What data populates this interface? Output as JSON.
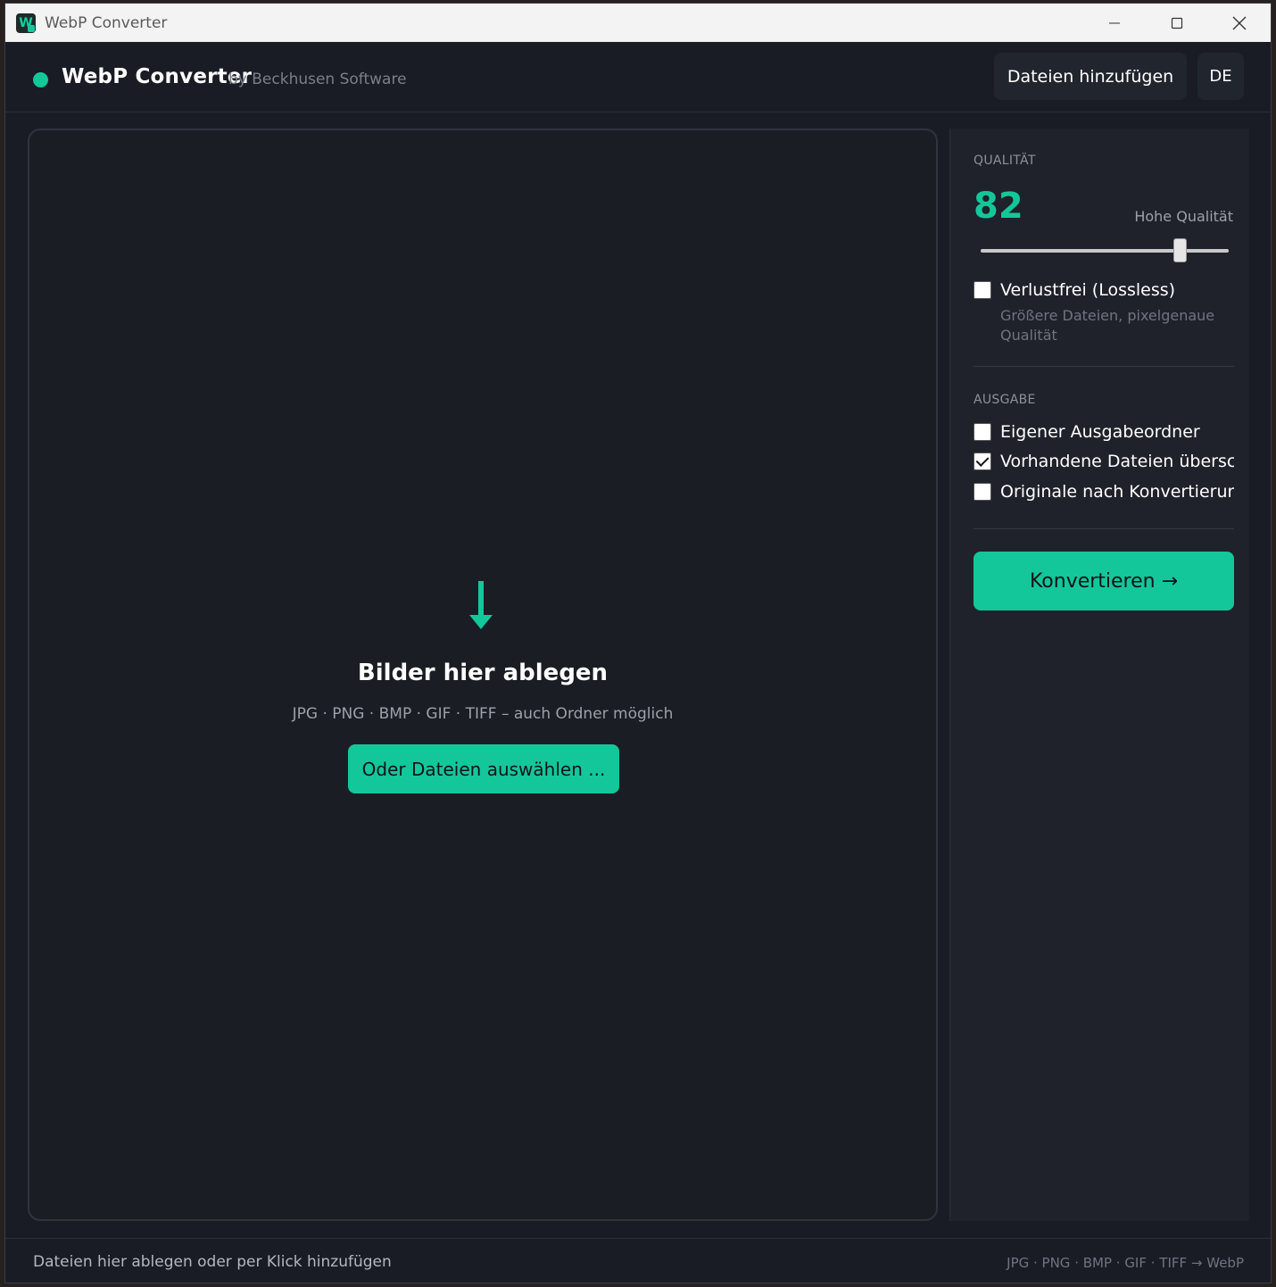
{
  "window": {
    "title": "WebP Converter",
    "controls": {
      "minimize": "—",
      "maximize": "☐",
      "close": "✕"
    }
  },
  "header": {
    "app_name": "WebP Converter",
    "byline": "by Beckhusen Software",
    "add_files_label": "Dateien hinzufügen",
    "language_label": "DE",
    "status_dot_color": "#14c79a"
  },
  "dropzone": {
    "icon": "arrow-down-icon",
    "title": "Bilder hier ablegen",
    "subtitle": "JPG · PNG · BMP · GIF · TIFF – auch Ordner möglich",
    "button_label": "Oder Dateien auswählen ..."
  },
  "sidebar": {
    "quality": {
      "section_label": "QUALITÄT",
      "value": "82",
      "description": "Hohe Qualität",
      "slider_value": 82,
      "slider_min": 0,
      "slider_max": 100
    },
    "lossless": {
      "label": "Verlustfrei (Lossless)",
      "checked": false,
      "hint": "Größere Dateien, pixelgenaue Qualität"
    },
    "output": {
      "section_label": "AUSGABE",
      "options": [
        {
          "label": "Eigener Ausgabeordner",
          "checked": false
        },
        {
          "label": "Vorhandene Dateien überschre",
          "checked": true
        },
        {
          "label": "Originale nach Konvertierung l",
          "checked": false
        }
      ]
    },
    "convert_label": "Konvertieren →"
  },
  "statusbar": {
    "left": "Dateien hier ablegen oder per Klick hinzufügen",
    "right": "JPG · PNG · BMP · GIF · TIFF → WebP"
  },
  "colors": {
    "accent": "#14c79a",
    "background": "#191c24",
    "panel": "#1f222a"
  }
}
